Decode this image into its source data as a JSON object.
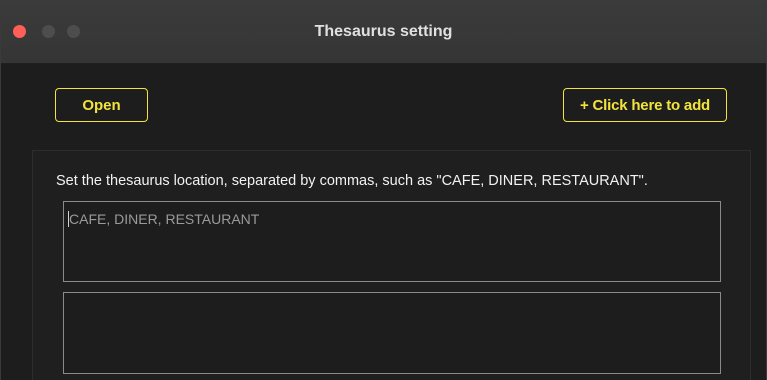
{
  "window": {
    "title": "Thesaurus setting"
  },
  "toolbar": {
    "open_label": "Open",
    "add_label": "+ Click here to add"
  },
  "form": {
    "instruction": "Set the thesaurus location, separated by commas, such as \"CAFE, DINER, RESTAURANT\".",
    "input1_placeholder": "CAFE, DINER, RESTAURANT",
    "input2_placeholder": ""
  },
  "colors": {
    "accent": "#f2e43a",
    "close_button": "#ff5f57",
    "background": "#1d1d1d"
  },
  "icons": {
    "close": "close-icon",
    "minimize": "minimize-icon",
    "maximize": "maximize-icon"
  }
}
